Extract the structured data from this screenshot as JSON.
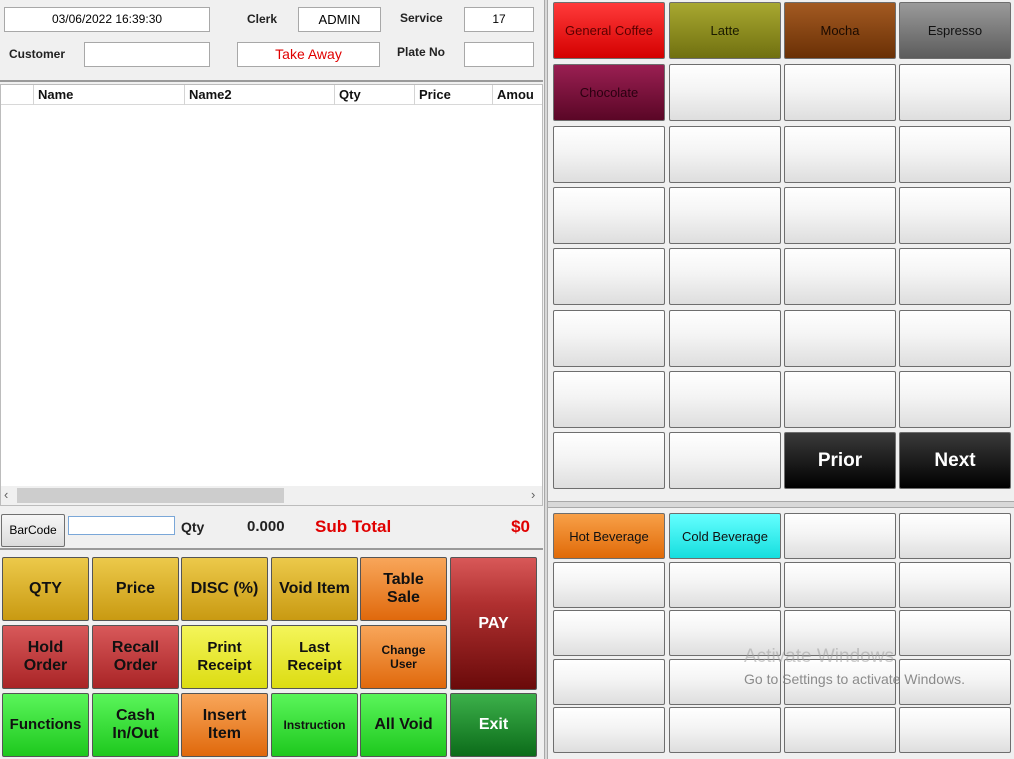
{
  "header": {
    "datetime": "03/06/2022 16:39:30",
    "clerk_label": "Clerk",
    "clerk_value": "ADMIN",
    "service_label": "Service",
    "service_value": "17",
    "customer_label": "Customer",
    "customer_value": "",
    "order_type": "Take Away",
    "plate_label": "Plate No",
    "plate_value": ""
  },
  "grid": {
    "columns": [
      "",
      "Name",
      "Name2",
      "Qty",
      "Price",
      "Amou"
    ],
    "rows": []
  },
  "strip": {
    "barcode_label": "BarCode",
    "barcode_value": "",
    "qty_label": "Qty",
    "qty_value": "0.000",
    "subtotal_label": "Sub Total",
    "subtotal_value": "$0"
  },
  "functions": {
    "qty": "QTY",
    "price": "Price",
    "disc": "DISC (%)",
    "void_item": "Void Item",
    "table_sale": "Table Sale",
    "pay": "PAY",
    "hold_order": "Hold Order",
    "recall_order": "Recall Order",
    "print_receipt": "Print Receipt",
    "last_receipt": "Last Receipt",
    "change_user": "Change User",
    "functions": "Functions",
    "cash_inout": "Cash In/Out",
    "insert_item": "Insert Item",
    "instruction": "Instruction",
    "all_void": "All Void",
    "exit": "Exit"
  },
  "products": {
    "items": [
      "General Coffee",
      "Latte",
      "Mocha",
      "Espresso",
      "Chocolate"
    ],
    "prior": "Prior",
    "next": "Next"
  },
  "categories": {
    "items": [
      "Hot Beverage",
      "Cold Beverage"
    ]
  },
  "watermark": {
    "title": "Activate Windows",
    "subtitle": "Go to Settings to activate Windows."
  }
}
